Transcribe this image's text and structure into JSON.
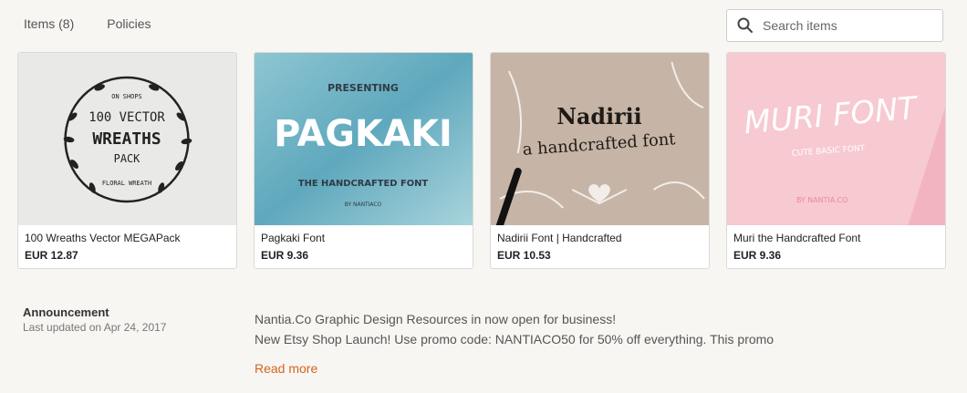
{
  "tabs": [
    {
      "label": "Items (8)"
    },
    {
      "label": "Policies"
    }
  ],
  "search": {
    "placeholder": "Search items",
    "icon": "search-icon"
  },
  "items": [
    {
      "title": "100 Wreaths Vector MEGAPack",
      "price": "EUR 12.87",
      "thumb_text": [
        "ON SHOPS",
        "100 VECTOR",
        "WREATHS",
        "PACK",
        "FLORAL WREATH"
      ]
    },
    {
      "title": "Pagkaki Font",
      "price": "EUR 9.36",
      "thumb_text": [
        "PRESENTING",
        "PAGKAKI",
        "THE HANDCRAFTED FONT",
        "BY NANTIACO"
      ]
    },
    {
      "title": "Nadirii Font | Handcrafted",
      "price": "EUR 10.53",
      "thumb_text": [
        "Nadirii",
        "a handcrafted font"
      ]
    },
    {
      "title": "Muri the Handcrafted Font",
      "price": "EUR 9.36",
      "thumb_text": [
        "MURI FONT",
        "CUTE BASIC FONT",
        "BY NANTIA.CO"
      ]
    }
  ],
  "announcement": {
    "title": "Announcement",
    "updated": "Last updated on Apr 24, 2017",
    "line1": "Nantia.Co Graphic Design Resources in now open for business!",
    "line2": "New Etsy Shop Launch! Use promo code: NANTIACO50 for 50% off everything. This promo",
    "read_more": "Read more"
  },
  "colors": {
    "accent_link": "#d5641c",
    "background": "#f8f6f3"
  }
}
